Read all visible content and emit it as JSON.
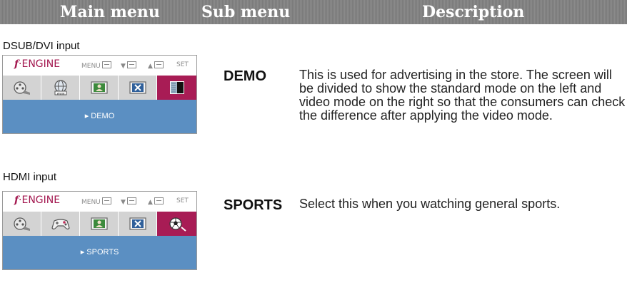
{
  "header": {
    "main_menu": "Main menu",
    "sub_menu": "Sub menu",
    "description": "Description"
  },
  "sections": [
    {
      "input_label": "DSUB/DVI input",
      "osd": {
        "logo_symbol": "f",
        "logo_text": "·ENGINE",
        "hint_menu": "MENU",
        "hint_down": "▼",
        "hint_up": "▲",
        "hint_set": "SET",
        "icons": [
          "movie-reel-icon",
          "internet-globe-icon",
          "user-portrait-icon",
          "close-x-icon",
          "demo-split-screen-icon"
        ],
        "active_index": 4,
        "selected_label": "▸ DEMO"
      },
      "sub_menu": "DEMO",
      "description": "This is used for advertising in the store. The screen will be divided to show the standard mode on the left and video mode on the right so that the consumers can check the difference after applying the video mode."
    },
    {
      "input_label": "HDMI input",
      "osd": {
        "logo_symbol": "f",
        "logo_text": "·ENGINE",
        "hint_menu": "MENU",
        "hint_down": "▼",
        "hint_up": "▲",
        "hint_set": "SET",
        "icons": [
          "movie-reel-icon",
          "game-controller-icon",
          "user-portrait-icon",
          "close-x-icon",
          "soccer-ball-icon"
        ],
        "active_index": 4,
        "selected_label": "▸ SPORTS"
      },
      "sub_menu": "SPORTS",
      "description": "Select this when you watching general sports."
    }
  ],
  "colors": {
    "header_bg": "#808080",
    "active_tab": "#a81c55",
    "panel_blue": "#5b8fc2",
    "logo_magenta": "#a3174f"
  }
}
